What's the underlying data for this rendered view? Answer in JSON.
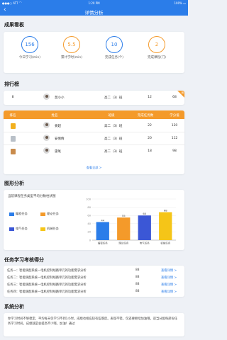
{
  "status": {
    "carrier": "●●●○ ATT ⌒",
    "time": "1:20 PM",
    "battery": "100% ▭"
  },
  "nav": {
    "title": "详情分析",
    "back": "‹"
  },
  "sections": {
    "results": "成果看板",
    "ranking": "排行榜",
    "chart": "图形分析",
    "tasks": "任务学习考核得分",
    "analysis": "系统分析"
  },
  "stats": [
    {
      "value": "156",
      "label": "今日学习(min)",
      "color": "#2b7de9"
    },
    {
      "value": "5.5",
      "label": "累计学时(min)",
      "color": "#f49a2a"
    },
    {
      "value": "10",
      "label": "完成任务(个)",
      "color": "#2b7de9"
    },
    {
      "value": "2",
      "label": "完成课程(门)",
      "color": "#f49a2a"
    }
  ],
  "ranking": {
    "me": {
      "rank": "8",
      "name": "莫小小",
      "class": "高二（3）班",
      "tasks": "12",
      "score": "68",
      "tag": "我"
    },
    "headers": [
      "排名",
      "姓名",
      "班级",
      "完成任务数",
      "学分值"
    ],
    "rows": [
      {
        "name": "姜超",
        "class": "高二（3）班",
        "tasks": "22",
        "score": "120",
        "medal": "#f2b01e"
      },
      {
        "name": "安倩倩",
        "class": "高二（3）班",
        "tasks": "20",
        "score": "112",
        "medal": "#b9c0c8"
      },
      {
        "name": "雷氧",
        "class": "高二（3）班",
        "tasks": "18",
        "score": "98",
        "medal": "#c98b4b"
      }
    ],
    "more": "查看全部 >"
  },
  "chart_title": "当前课程任务类型平均分数柱状图",
  "legend": [
    {
      "label": "编程任务",
      "color": "#2b7de9"
    },
    {
      "label": "理论任务",
      "color": "#f49a2a"
    },
    {
      "label": "电气任务",
      "color": "#3b57d6"
    },
    {
      "label": "机械任务",
      "color": "#f5c518"
    }
  ],
  "chart_data": {
    "type": "bar",
    "title": "",
    "xlabel": "",
    "ylabel": "",
    "categories": [
      "编程任务",
      "理论任务",
      "电气任务",
      "机械任务"
    ],
    "values": [
      44,
      55,
      60,
      68
    ],
    "colors": [
      "#2b7de9",
      "#f49a2a",
      "#3b57d6",
      "#f5c518"
    ],
    "ylim": [
      0,
      100
    ],
    "yticks": [
      0,
      20,
      40,
      60,
      80,
      100
    ],
    "grid": true
  },
  "tasks": [
    {
      "title": "任务一：智能调配系统—电机控制线路单元的功能需求分析",
      "score": "88",
      "detail": "查看详情 >"
    },
    {
      "title": "任务二：智能调配系统—电机控制线路单元的功能需求分析",
      "score": "88",
      "detail": "查看详情 >"
    },
    {
      "title": "任务三：智能调配系统—电机控制线路单元的功能需求分析",
      "score": "88",
      "detail": "查看详情 >"
    },
    {
      "title": "任务四：智能调配系统—电机控制线路单元的功能需求分析",
      "score": "88",
      "detail": "查看详情 >"
    }
  ],
  "analysis": "你学习时间不够稳定，平均每天仅学习不到1小时，成绩也相应较有些落后。表现不错，仅还要继续加油哦，适当分配每部份任务学习时间，成绩就是会提高不少哦，加油！通过"
}
